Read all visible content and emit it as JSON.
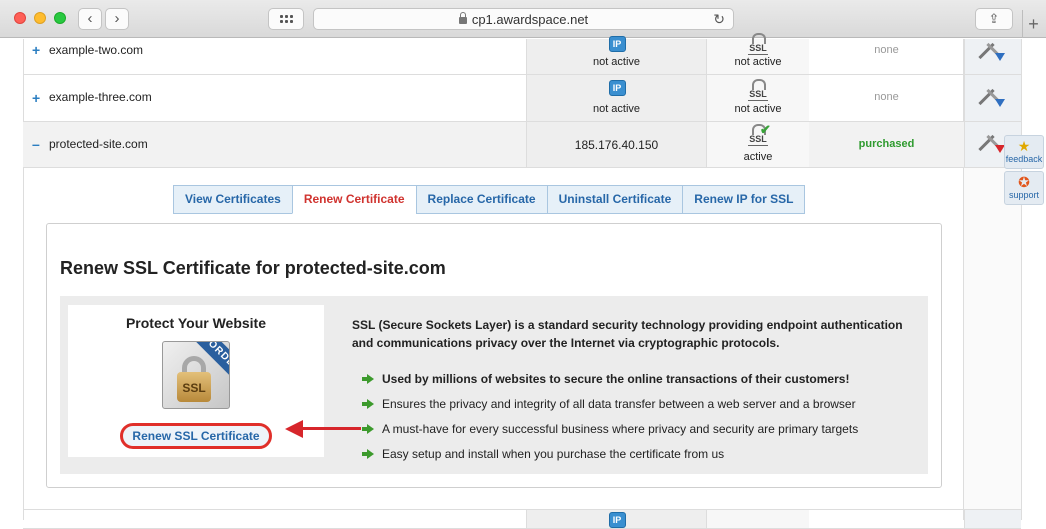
{
  "browser": {
    "url": "cp1.awardspace.net",
    "back_icon": "chevron-left-icon",
    "forward_icon": "chevron-right-icon"
  },
  "domains": [
    {
      "name": "example-two.com",
      "expand": "+",
      "ip": "not active",
      "ssl": "not active",
      "status": "none"
    },
    {
      "name": "example-three.com",
      "expand": "+",
      "ip": "not active",
      "ssl": "not active",
      "status": "none"
    },
    {
      "name": "protected-site.com",
      "expand": "–",
      "ip": "185.176.40.150",
      "ssl": "active",
      "status": "purchased"
    }
  ],
  "tabs": [
    "View Certificates",
    "Renew Certificate",
    "Replace Certificate",
    "Uninstall Certificate",
    "Renew IP for SSL"
  ],
  "active_tab": "Renew Certificate",
  "panel": {
    "title": "Renew SSL Certificate for protected-site.com",
    "protect_title": "Protect Your Website",
    "product_ribbon": "ORDER",
    "product_label": "SSL",
    "renew_button": "Renew SSL Certificate",
    "description": "SSL (Secure Sockets Layer) is a standard security technology providing endpoint authentication and communications privacy over the Internet via cryptographic protocols.",
    "bullets": [
      "Used by millions of websites to secure the online transactions of their customers!",
      "Ensures the privacy and integrity of all data transfer between a web server and a browser",
      "A must-have for every successful business where privacy and security are primary targets",
      "Easy setup and install when you purchase the certificate from us"
    ]
  },
  "sidebar": {
    "feedback": "feedback",
    "support": "support"
  },
  "colors": {
    "link": "#2767a8",
    "active_tab": "#d0332f",
    "purchased": "#2e9a2e",
    "highlight": "#e02f2a"
  }
}
